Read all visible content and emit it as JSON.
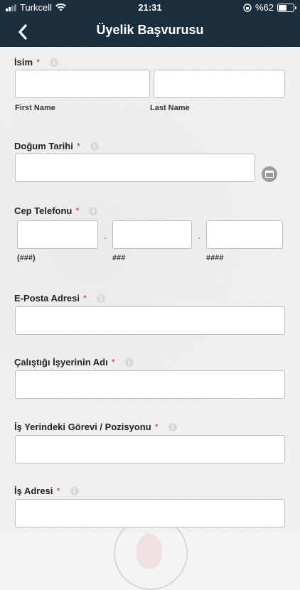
{
  "status": {
    "carrier": "Turkcell",
    "time": "21:31",
    "battery": "%62",
    "battery_level": 0.62
  },
  "nav": {
    "title": "Üyelik Başvurusu"
  },
  "form": {
    "name": {
      "label": "İsim",
      "first": "First Name",
      "last": "Last Name"
    },
    "birth": {
      "label": "Doğum Tarihi"
    },
    "phone": {
      "label": "Cep Telefonu",
      "sub1": "(###)",
      "sub2": "###",
      "sub3": "####",
      "dash": "-"
    },
    "email": {
      "label": "E-Posta Adresi"
    },
    "employer": {
      "label": "Çalıştığı İşyerinin Adı"
    },
    "position": {
      "label": "İş Yerindeki Görevi / Pozisyonu"
    },
    "address": {
      "label": "İş Adresi"
    },
    "required": "*",
    "info": "i"
  },
  "icons": {
    "back": "chevron-left-icon",
    "calendar": "calendar-icon",
    "wifi": "wifi-icon",
    "lock": "orientation-lock-icon"
  }
}
